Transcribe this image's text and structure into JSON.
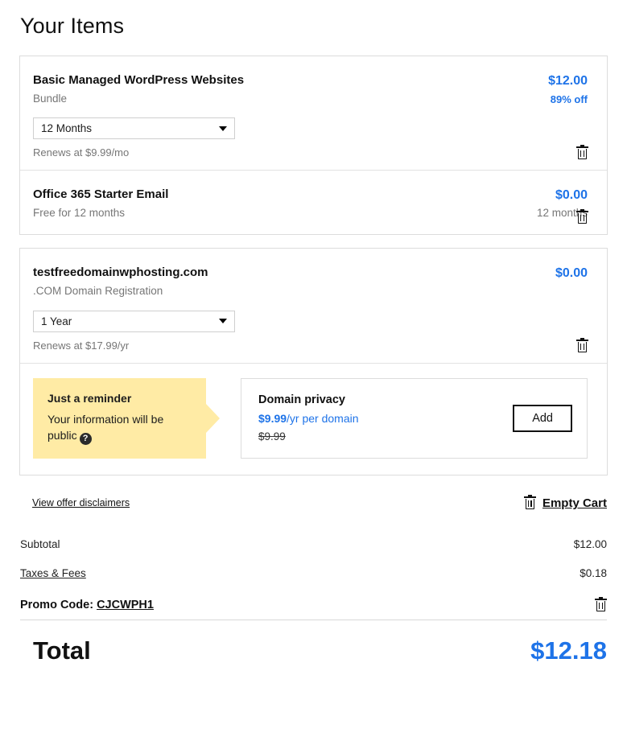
{
  "header": {
    "title": "Your Items"
  },
  "cards": [
    {
      "items": [
        {
          "title": "Basic Managed WordPress Websites",
          "subtitle": "Bundle",
          "price": "$12.00",
          "discount": "89% off",
          "term_value": "12 Months",
          "renews": "Renews at $9.99/mo",
          "remove_icon": "trash-icon"
        },
        {
          "title": "Office 365 Starter Email",
          "subtitle": "Free for 12 months",
          "price": "$0.00",
          "term_note": "12 months",
          "remove_icon": "trash-icon"
        }
      ]
    },
    {
      "items": [
        {
          "title": "testfreedomainwphosting.com",
          "subtitle": ".COM Domain Registration",
          "price": "$0.00",
          "term_value": "1 Year",
          "renews": "Renews at $17.99/yr",
          "remove_icon": "trash-icon"
        }
      ],
      "privacy": {
        "reminder_title": "Just a reminder",
        "reminder_text": "Your information will be public",
        "help_icon": "help-circle-icon",
        "offer_title": "Domain privacy",
        "offer_price_amount": "$9.99",
        "offer_price_unit": "/yr per domain",
        "offer_old_price": "$9.99",
        "add_label": "Add"
      }
    }
  ],
  "links": {
    "disclaimers": "View offer disclaimers",
    "empty_cart": "Empty Cart",
    "empty_cart_icon": "trash-icon"
  },
  "summary": {
    "rows": [
      {
        "label": "Subtotal",
        "value": "$12.00",
        "is_link": false
      },
      {
        "label": "Taxes & Fees",
        "value": "$0.18",
        "is_link": true
      }
    ],
    "promo_label": "Promo Code:",
    "promo_code": "CJCWPH1",
    "promo_remove_icon": "trash-icon",
    "total_label": "Total",
    "total_amount": "$12.18"
  },
  "colors": {
    "accent_blue": "#1e73e8",
    "reminder_yellow": "#ffeba5",
    "muted_gray": "#767676",
    "border_gray": "#dcdcdc"
  }
}
